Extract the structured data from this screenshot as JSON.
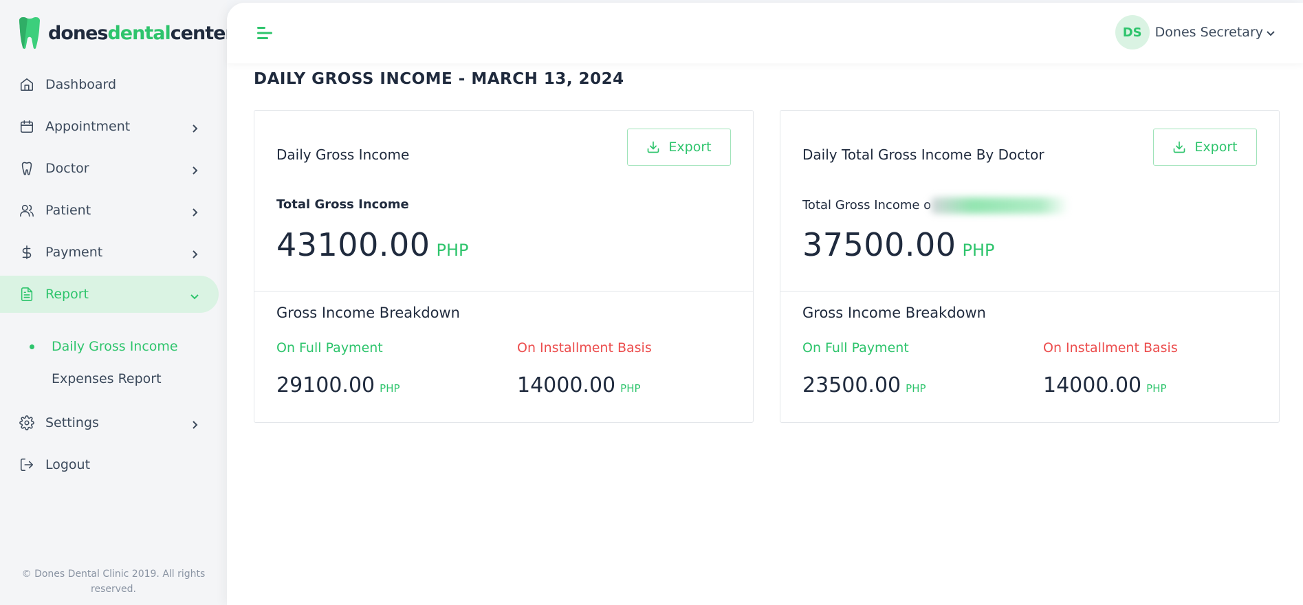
{
  "brand": {
    "part1": "dones",
    "part2": "dental",
    "part3": "center"
  },
  "sidebar": {
    "items": [
      {
        "label": "Dashboard"
      },
      {
        "label": "Appointment"
      },
      {
        "label": "Doctor"
      },
      {
        "label": "Patient"
      },
      {
        "label": "Payment"
      },
      {
        "label": "Report"
      },
      {
        "label": "Settings"
      },
      {
        "label": "Logout"
      }
    ],
    "report_sub": [
      {
        "label": "Daily Gross Income"
      },
      {
        "label": "Expenses Report"
      }
    ],
    "footer": "© Dones Dental Clinic 2019. All rights reserved."
  },
  "topbar": {
    "avatar_initials": "DS",
    "user_name": "Dones Secretary"
  },
  "page": {
    "title": "DAILY GROSS INCOME - MARCH 13, 2024"
  },
  "cards": [
    {
      "title": "Daily Gross Income",
      "export_label": "Export",
      "total_label": "Total Gross Income",
      "total_value": "43100.00",
      "currency": "PHP",
      "breakdown_title": "Gross Income Breakdown",
      "full_label": "On Full Payment",
      "full_value": "29100.00",
      "installment_label": "On Installment Basis",
      "installment_value": "14000.00"
    },
    {
      "title": "Daily Total Gross Income By Doctor",
      "export_label": "Export",
      "total_label": "Total Gross Income o",
      "total_value": "37500.00",
      "currency": "PHP",
      "breakdown_title": "Gross Income Breakdown",
      "full_label": "On Full Payment",
      "full_value": "23500.00",
      "installment_label": "On Installment Basis",
      "installment_value": "14000.00"
    }
  ],
  "colors": {
    "accent": "#2ec46c",
    "danger": "#ec4d4d",
    "text": "#1f2a3d",
    "sidebar_bg": "#f4f5f7"
  }
}
